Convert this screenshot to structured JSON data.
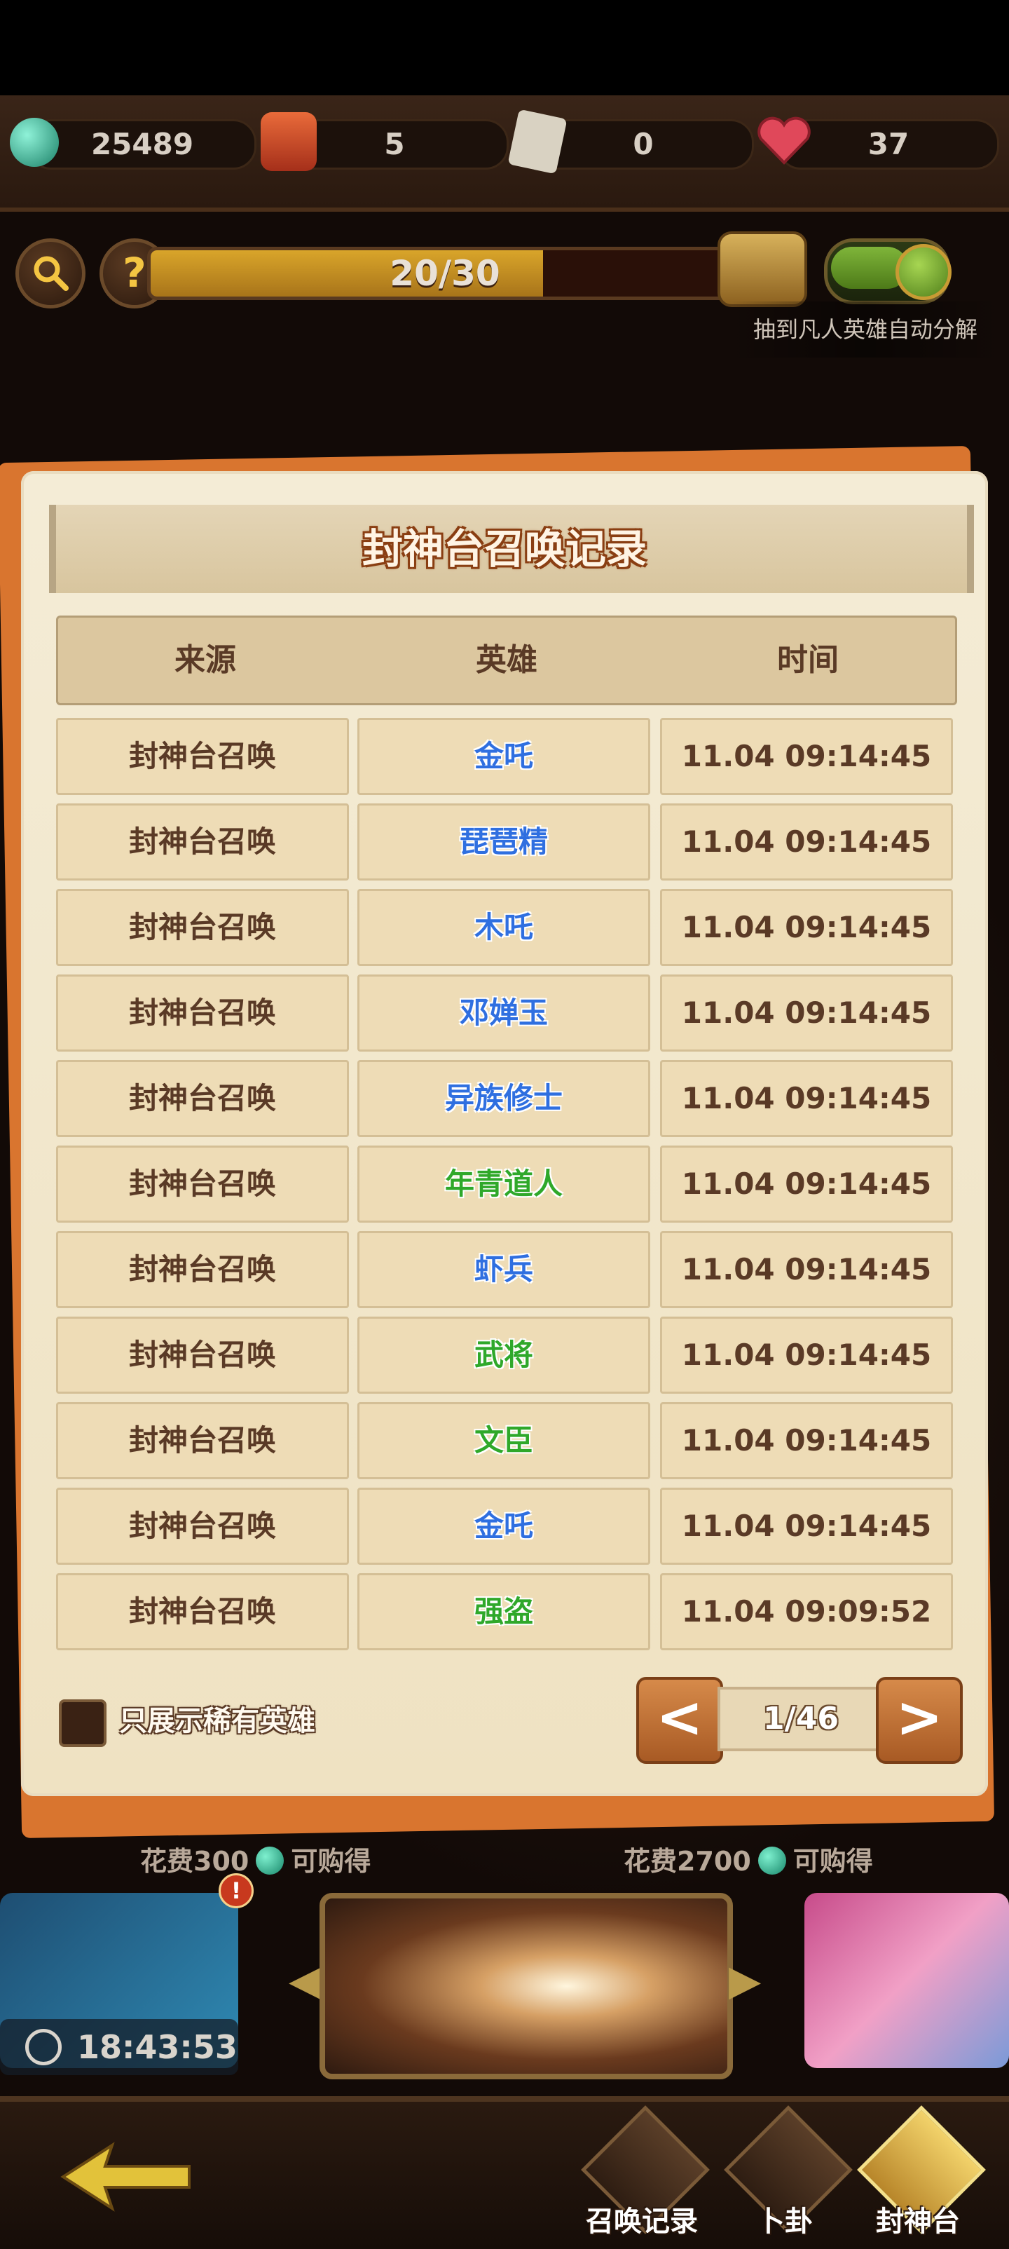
{
  "resources": [
    {
      "icon": "jade-coin-icon",
      "value": "25489"
    },
    {
      "icon": "hero-figure-icon",
      "value": "5"
    },
    {
      "icon": "ticket-icon",
      "value": "0"
    },
    {
      "icon": "heart-icon",
      "value": "37"
    }
  ],
  "progress": {
    "text": "20/30",
    "fraction": 0.6667
  },
  "auto_decompose": {
    "label": "抽到凡人英雄自动分解",
    "enabled": true
  },
  "dialog": {
    "title": "封神台召唤记录",
    "headers": [
      "来源",
      "英雄",
      "时间"
    ],
    "rows": [
      {
        "source": "封神台召唤",
        "hero": "金吒",
        "hero_color": "#2f6fe0",
        "time": "11.04 09:14:45"
      },
      {
        "source": "封神台召唤",
        "hero": "琵琶精",
        "hero_color": "#2f6fe0",
        "time": "11.04 09:14:45"
      },
      {
        "source": "封神台召唤",
        "hero": "木吒",
        "hero_color": "#2f6fe0",
        "time": "11.04 09:14:45"
      },
      {
        "source": "封神台召唤",
        "hero": "邓婵玉",
        "hero_color": "#2f6fe0",
        "time": "11.04 09:14:45"
      },
      {
        "source": "封神台召唤",
        "hero": "异族修士",
        "hero_color": "#2f6fe0",
        "time": "11.04 09:14:45"
      },
      {
        "source": "封神台召唤",
        "hero": "年青道人",
        "hero_color": "#2fa82a",
        "time": "11.04 09:14:45"
      },
      {
        "source": "封神台召唤",
        "hero": "虾兵",
        "hero_color": "#2f6fe0",
        "time": "11.04 09:14:45"
      },
      {
        "source": "封神台召唤",
        "hero": "武将",
        "hero_color": "#2fa82a",
        "time": "11.04 09:14:45"
      },
      {
        "source": "封神台召唤",
        "hero": "文臣",
        "hero_color": "#2fa82a",
        "time": "11.04 09:14:45"
      },
      {
        "source": "封神台召唤",
        "hero": "金吒",
        "hero_color": "#2f6fe0",
        "time": "11.04 09:14:45"
      },
      {
        "source": "封神台召唤",
        "hero": "强盗",
        "hero_color": "#2fa82a",
        "time": "11.04 09:09:52"
      }
    ],
    "rare_only_label": "只展示稀有英雄",
    "prev_label": "<",
    "next_label": ">",
    "page": "1/46"
  },
  "buy_left": {
    "prefix": "花费300",
    "suffix": "可购得"
  },
  "buy_right": {
    "prefix": "花费2700",
    "suffix": "可购得"
  },
  "timer": "18:43:53",
  "alert": "!",
  "nav": {
    "record": "召唤记录",
    "divination": "卜卦",
    "altar": "封神台"
  },
  "colors": {
    "dialog_title_outline": "#8a3f13",
    "dialog_bg": "#f4ecd6",
    "accent_orange": "#d9752f"
  }
}
